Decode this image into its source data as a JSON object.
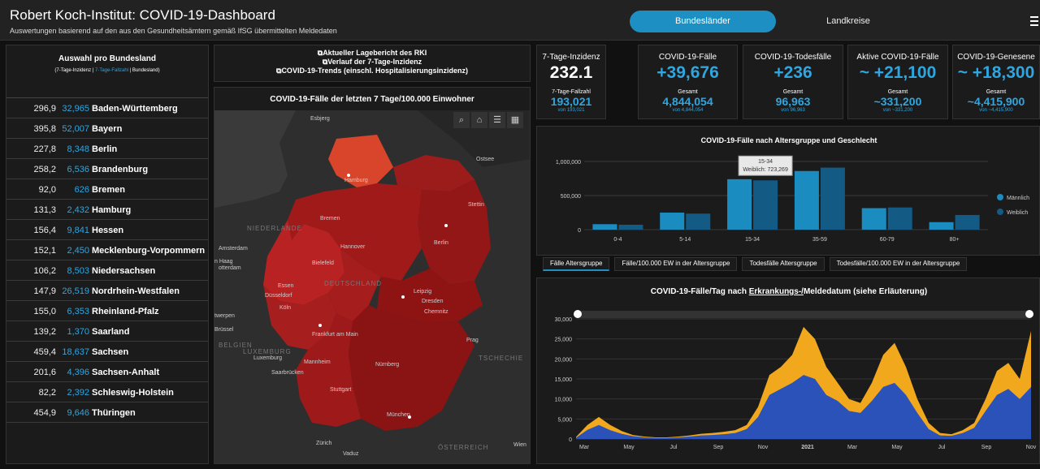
{
  "header": {
    "title": "Robert Koch-Institut: COVID-19-Dashboard",
    "subtitle": "Auswertungen basierend auf den aus den Gesundheitsämtern gemäß IfSG übermittelten Meldedaten",
    "tab_active": "Bundesländer",
    "tab_inactive": "Landkreise"
  },
  "leftpanel": {
    "title": "Auswahl pro Bundesland",
    "sub_a": "(7-Tage-Inzidenz | ",
    "sub_b": "7-Tage-Fallzahl",
    "sub_c": " | Bundesland)",
    "rows": [
      {
        "inz": "296,9",
        "cnt": "32,965",
        "name": "Baden-Württemberg"
      },
      {
        "inz": "395,8",
        "cnt": "52,007",
        "name": "Bayern"
      },
      {
        "inz": "227,8",
        "cnt": "8,348",
        "name": "Berlin"
      },
      {
        "inz": "258,2",
        "cnt": "6,536",
        "name": "Brandenburg"
      },
      {
        "inz": "92,0",
        "cnt": "626",
        "name": "Bremen"
      },
      {
        "inz": "131,3",
        "cnt": "2,432",
        "name": "Hamburg"
      },
      {
        "inz": "156,4",
        "cnt": "9,841",
        "name": "Hessen"
      },
      {
        "inz": "152,1",
        "cnt": "2,450",
        "name": "Mecklenburg-Vorpommern"
      },
      {
        "inz": "106,2",
        "cnt": "8,503",
        "name": "Niedersachsen"
      },
      {
        "inz": "147,9",
        "cnt": "26,519",
        "name": "Nordrhein-Westfalen"
      },
      {
        "inz": "155,0",
        "cnt": "6,353",
        "name": "Rheinland-Pfalz"
      },
      {
        "inz": "139,2",
        "cnt": "1,370",
        "name": "Saarland"
      },
      {
        "inz": "459,4",
        "cnt": "18,637",
        "name": "Sachsen"
      },
      {
        "inz": "201,6",
        "cnt": "4,396",
        "name": "Sachsen-Anhalt"
      },
      {
        "inz": "82,2",
        "cnt": "2,392",
        "name": "Schleswig-Holstein"
      },
      {
        "inz": "454,9",
        "cnt": "9,646",
        "name": "Thüringen"
      }
    ]
  },
  "links": {
    "l1": "Aktueller Lagebericht des RKI",
    "l2": "Verlauf der 7-Tage-Inzidenz",
    "l3": "COVID-19-Trends (einschl. Hospitalisierungsinzidenz)"
  },
  "map": {
    "title": "COVID-19-Fälle der letzten 7 Tage/100.000 Einwohner",
    "labels": [
      "Esbjerg",
      "Ostsee",
      "Hamburg",
      "Stettin",
      "Bremen",
      "NIEDERLANDE",
      "Amsterdam",
      "Hannover",
      "Berlin",
      "n Haag",
      "otterdam",
      "Bielefeld",
      "DEUTSCHLAND",
      "Essen",
      "Düsseldorf",
      "Leipzig",
      "Köln",
      "Dresden",
      "Chemnitz",
      "twerpen",
      "Brüssel",
      "BELGIEN",
      "Prag",
      "Frankfurt am Main",
      "LUXEMBURG",
      "Luxemburg",
      "TSCHECHIE",
      "Mannheim",
      "Nürnberg",
      "Saarbrücken",
      "Stuttgart",
      "München",
      "Wien",
      "Zürich",
      "ÖSTERREICH",
      "Vaduz"
    ]
  },
  "kpis": [
    {
      "label": "7-Tage-Inzidenz",
      "value": "232.1",
      "sub": "7-Tage-Fallzahl",
      "big": "193,021",
      "small": "von 193,021"
    },
    {
      "label": "COVID-19-Fälle",
      "value": "+39,676",
      "sub": "Gesamt",
      "big": "4,844,054",
      "small": "von 4,844,054"
    },
    {
      "label": "COVID-19-Todesfälle",
      "value": "+236",
      "sub": "Gesamt",
      "big": "96,963",
      "small": "von 96,963"
    },
    {
      "label": "Aktive COVID-19-Fälle",
      "value": "~ +21,100",
      "sub": "Gesamt",
      "big": "~331,200",
      "small": "von ~331,200"
    },
    {
      "label": "COVID-19-Genesene",
      "value": "~ +18,300",
      "sub": "Gesamt",
      "big": "~4,415,900",
      "small": "von ~4,415,900"
    }
  ],
  "age_tabs": [
    "Fälle Altersgruppe",
    "Fälle/100.000 EW in der Altersgruppe",
    "Todesfälle Altersgruppe",
    "Todesfälle/100.000 EW in der Altersgruppe"
  ],
  "tooltip": {
    "l1": "15-34",
    "l2": "Weiblich: 723,269"
  },
  "chart_data": [
    {
      "type": "bar",
      "title": "COVID-19-Fälle nach Altersgruppe und Geschlecht",
      "categories": [
        "0-4",
        "5-14",
        "15-34",
        "35-59",
        "60-79",
        "80+"
      ],
      "series": [
        {
          "name": "Männlich",
          "values": [
            80000,
            250000,
            740000,
            860000,
            315000,
            110000
          ]
        },
        {
          "name": "Weiblich",
          "values": [
            72000,
            235000,
            723269,
            910000,
            325000,
            215000
          ]
        }
      ],
      "ylim": [
        0,
        1000000
      ],
      "yticks": [
        "0",
        "500,000",
        "1,000,000"
      ],
      "colors": {
        "Männlich": "#1a8cbf",
        "Weiblich": "#135a85"
      },
      "legend": "right"
    },
    {
      "type": "area",
      "title_pre": "COVID-19-Fälle/Tag nach ",
      "title_link": "Erkrankungs-/",
      "title_post": "Meldedatum (siehe Erläuterung)",
      "x_labels": [
        "Mar",
        "May",
        "Jul",
        "Sep",
        "Nov",
        "2021",
        "Mar",
        "May",
        "Jul",
        "Sep",
        "Nov"
      ],
      "yticks": [
        "0",
        "5,000",
        "10,000",
        "15,000",
        "20,000",
        "25,000",
        "30,000"
      ],
      "ylim": [
        0,
        30000
      ],
      "series": [
        {
          "name": "",
          "color": "#f2a81d",
          "values": [
            500,
            3500,
            5500,
            3500,
            2000,
            1000,
            600,
            400,
            400,
            600,
            900,
            1300,
            1500,
            1800,
            2200,
            3500,
            8000,
            16000,
            18000,
            21000,
            28000,
            25000,
            18000,
            14000,
            10000,
            9000,
            14000,
            21000,
            24000,
            18000,
            10000,
            4000,
            1500,
            1200,
            2200,
            4000,
            10000,
            17000,
            19000,
            15000,
            27000
          ]
        },
        {
          "name": "",
          "color": "#2b52b8",
          "values": [
            300,
            2300,
            3500,
            2200,
            1300,
            700,
            400,
            250,
            250,
            400,
            600,
            900,
            1000,
            1200,
            1500,
            2500,
            5500,
            11000,
            12500,
            14000,
            16000,
            15000,
            11000,
            9500,
            7000,
            6500,
            9500,
            13000,
            14000,
            11000,
            6500,
            2500,
            900,
            800,
            1500,
            2800,
            7000,
            11000,
            12500,
            10000,
            13000
          ]
        }
      ]
    }
  ]
}
